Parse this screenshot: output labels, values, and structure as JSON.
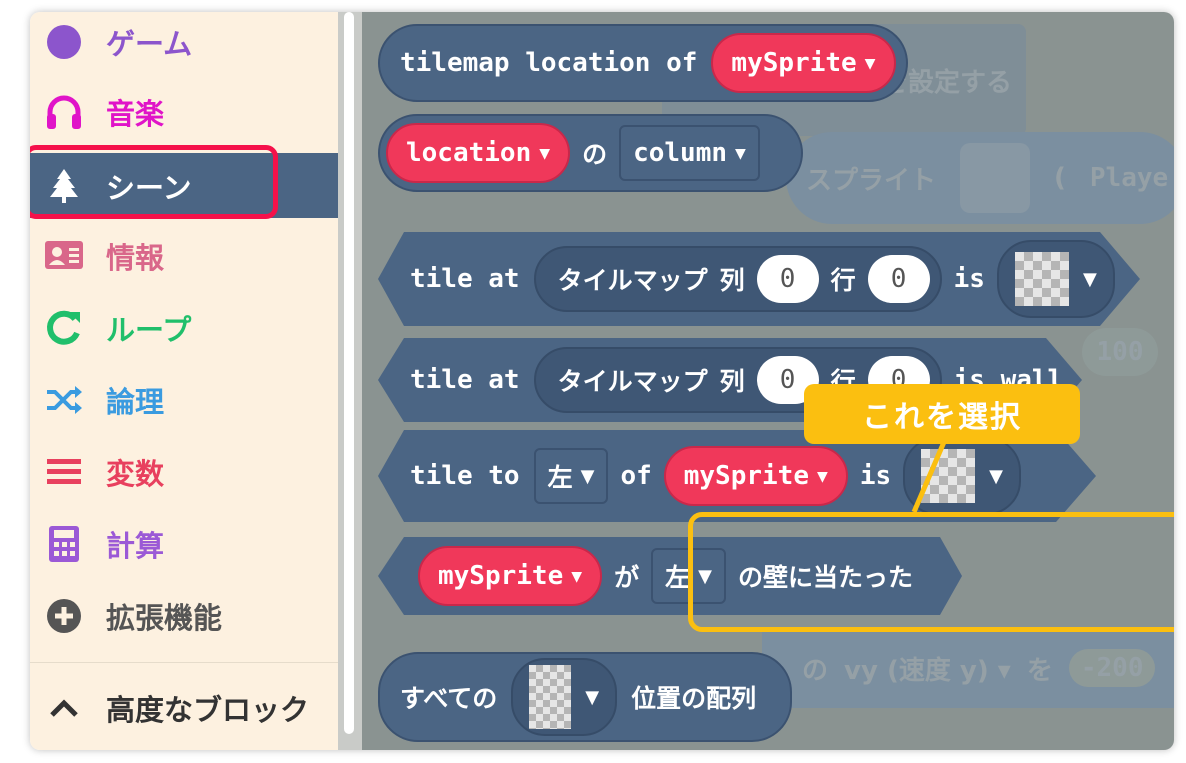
{
  "sidebar": {
    "items": [
      {
        "label": "ゲーム",
        "icon": "circle-icon",
        "color": "#8c55cc"
      },
      {
        "label": "音楽",
        "icon": "headphones-icon",
        "color": "#e014c8"
      },
      {
        "label": "シーン",
        "icon": "tree-icon",
        "color": "#ffffff",
        "selected": true
      },
      {
        "label": "情報",
        "icon": "id-card-icon",
        "color": "#d9678a"
      },
      {
        "label": "ループ",
        "icon": "refresh-icon",
        "color": "#20bf6b"
      },
      {
        "label": "論理",
        "icon": "shuffle-icon",
        "color": "#3a9be0"
      },
      {
        "label": "変数",
        "icon": "list-icon",
        "color": "#e8405e"
      },
      {
        "label": "計算",
        "icon": "calculator-icon",
        "color": "#9b59d6"
      },
      {
        "label": "拡張機能",
        "icon": "plus-circle-icon",
        "color": "#555555"
      },
      {
        "label": "高度なブロック",
        "icon": "chevron-up-icon",
        "color": "#333333"
      }
    ]
  },
  "background_blocks": {
    "set_text": "を設定する",
    "sprite": "スプライト",
    "paren": "(",
    "player": "Playe",
    "num100": "100",
    "vy_of": "の",
    "vy": "vy (速度 y) ▾",
    "wo": "を",
    "num_neg200": "-200"
  },
  "blocks": {
    "b1": {
      "text": "tilemap location of",
      "sprite": "mySprite"
    },
    "b2": {
      "location": "location",
      "no": "の",
      "column": "column"
    },
    "b3": {
      "tile_at": "tile at",
      "tilemap": "タイルマップ",
      "col": "列",
      "col_val": "0",
      "row": "行",
      "row_val": "0",
      "is": "is"
    },
    "b4": {
      "tile_at": "tile at",
      "tilemap": "タイルマップ",
      "col": "列",
      "col_val": "0",
      "row": "行",
      "row_val": "0",
      "is_wall": "is wall"
    },
    "b5": {
      "tile_to": "tile to",
      "dir": "左",
      "of": "of",
      "sprite": "mySprite",
      "is": "is"
    },
    "b6": {
      "sprite": "mySprite",
      "ga": "が",
      "dir": "左",
      "suffix": "の壁に当たった"
    },
    "b7": {
      "all": "すべての",
      "suffix": "位置の配列"
    }
  },
  "callout": {
    "text": "これを選択",
    "color": "#fbbf10"
  },
  "colors": {
    "block": "#4b6584",
    "sprite": "#f0385a",
    "highlight": "#f5114a"
  }
}
